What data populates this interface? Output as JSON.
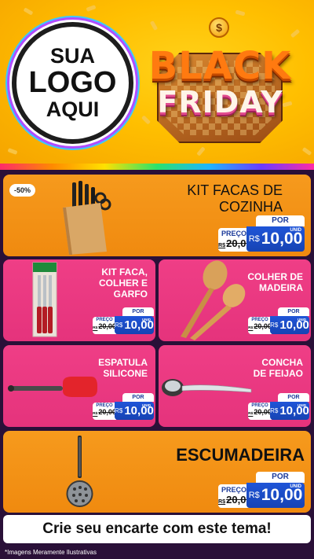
{
  "colors": {
    "header_yellow": "#ffbf00",
    "card_orange": "#f08a0f",
    "card_pink": "#e5337c",
    "price_blue": "#1643b3"
  },
  "header": {
    "logo_lines": [
      "SUA",
      "LOGO",
      "AQUI"
    ],
    "badge_coin": "$",
    "badge_word_1": "BLACK",
    "badge_word_2": "FRIDAY"
  },
  "products": [
    {
      "id": "kit-facas",
      "title_lines": [
        "KIT FACAS DE",
        "COZINHA"
      ],
      "discount": "-50%",
      "icon": "knife-block-icon",
      "price": {
        "por": "POR",
        "preco": "PREÇO",
        "old_currency": "R$",
        "old": "20,00",
        "currency": "R$",
        "new": "10,00",
        "unit": "UNID"
      }
    },
    {
      "id": "kit-faca-colher-garfo",
      "title_lines": [
        "KIT FACA,",
        "COLHER E",
        "GARFO"
      ],
      "icon": "cutlery-pack-icon",
      "price": {
        "por": "POR",
        "preco": "PREÇO",
        "old_currency": "R$",
        "old": "20,00",
        "currency": "R$",
        "new": "10,00",
        "unit": "UNID"
      }
    },
    {
      "id": "colher-madeira",
      "title_lines": [
        "COLHER DE",
        "MADEIRA"
      ],
      "icon": "wooden-spoons-icon",
      "price": {
        "por": "POR",
        "preco": "PREÇO",
        "old_currency": "R$",
        "old": "20,00",
        "currency": "R$",
        "new": "10,00",
        "unit": "UNID"
      }
    },
    {
      "id": "espatula-silicone",
      "title_lines": [
        "ESPATULA",
        "SILICONE"
      ],
      "icon": "spatula-icon",
      "price": {
        "por": "POR",
        "preco": "PREÇO",
        "old_currency": "R$",
        "old": "20,00",
        "currency": "R$",
        "new": "10,00",
        "unit": "UNID"
      }
    },
    {
      "id": "concha-feijao",
      "title_lines": [
        "CONCHA",
        "DE FEIJAO"
      ],
      "icon": "ladle-icon",
      "price": {
        "por": "POR",
        "preco": "PREÇO",
        "old_currency": "R$",
        "old": "20,00",
        "currency": "R$",
        "new": "10,00",
        "unit": "UNID"
      }
    },
    {
      "id": "escumadeira",
      "title_lines": [
        "ESCUMADEIRA"
      ],
      "icon": "skimmer-icon",
      "price": {
        "por": "POR",
        "preco": "PREÇO",
        "old_currency": "R$",
        "old": "20,00",
        "currency": "R$",
        "new": "10,00",
        "unit": "UNID"
      }
    }
  ],
  "cta": "Crie seu encarte com este tema!",
  "disclaimer": "*Imagens Meramente Ilustrativas"
}
